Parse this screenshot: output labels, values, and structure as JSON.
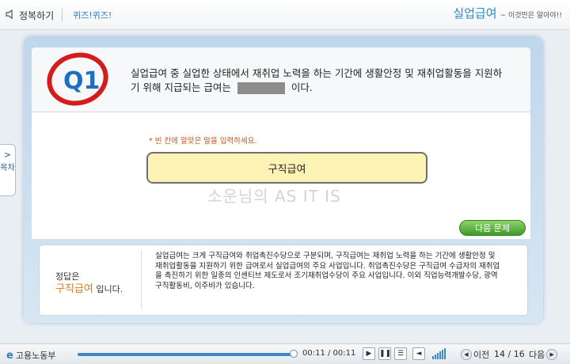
{
  "header": {
    "course_title": "정복하기",
    "section": "퀴즈!퀴즈!",
    "brand_title": "실업급여",
    "brand_tagline": "~ 이것만은 알아야!!"
  },
  "question": {
    "badge": "Q1",
    "text_before": "실업급여 중 실업한 상태에서 재취업 노력을 하는 기간에 생활안정 및 재취업활동을 지원하기 위해 지급되는 급여는",
    "text_after": "이다.",
    "hint": "* 빈 칸에 알맞은 말을 입력하세요.",
    "answer_value": "구직급여"
  },
  "watermark": "소운님의 AS IT IS",
  "next_button": "다음 문제",
  "explanation": {
    "answer_prefix": "정답은",
    "answer": "구직급여",
    "answer_suffix": "입니다.",
    "text": "실업급여는 크게 구직급여와 취업촉진수당으로 구분되며, 구직급여는 재취업 노력을 하는 기간에 생활안정 및 재취업활동을 지원하기 위한 급여로서 실업급여의 주요 사업입니다. 취업촉진수당은 구직급여 수급자의 재취업을 촉진하기 위한 일종의 인센티브 제도로서 조기재취업수당이 주요 사업입니다. 이외 직업능력개발수당, 광역구직활동비, 이주비가 있습니다."
  },
  "toc": {
    "chevron": ">",
    "label": "목차"
  },
  "footer": {
    "ministry": "고용노동부",
    "time": "00:11 / 00:11",
    "progress": 1.0,
    "prev_label": "이전",
    "next_label": "다음",
    "current_page": "14",
    "total_pages": "16"
  },
  "colors": {
    "accent": "#2a8bc8",
    "answer": "#d4800b",
    "next_button": "#4caf34"
  },
  "icons": [
    "speaker-icon",
    "play-icon",
    "pause-icon",
    "menu-icon",
    "volume-icon",
    "prev-arrow-icon",
    "next-arrow-icon"
  ]
}
